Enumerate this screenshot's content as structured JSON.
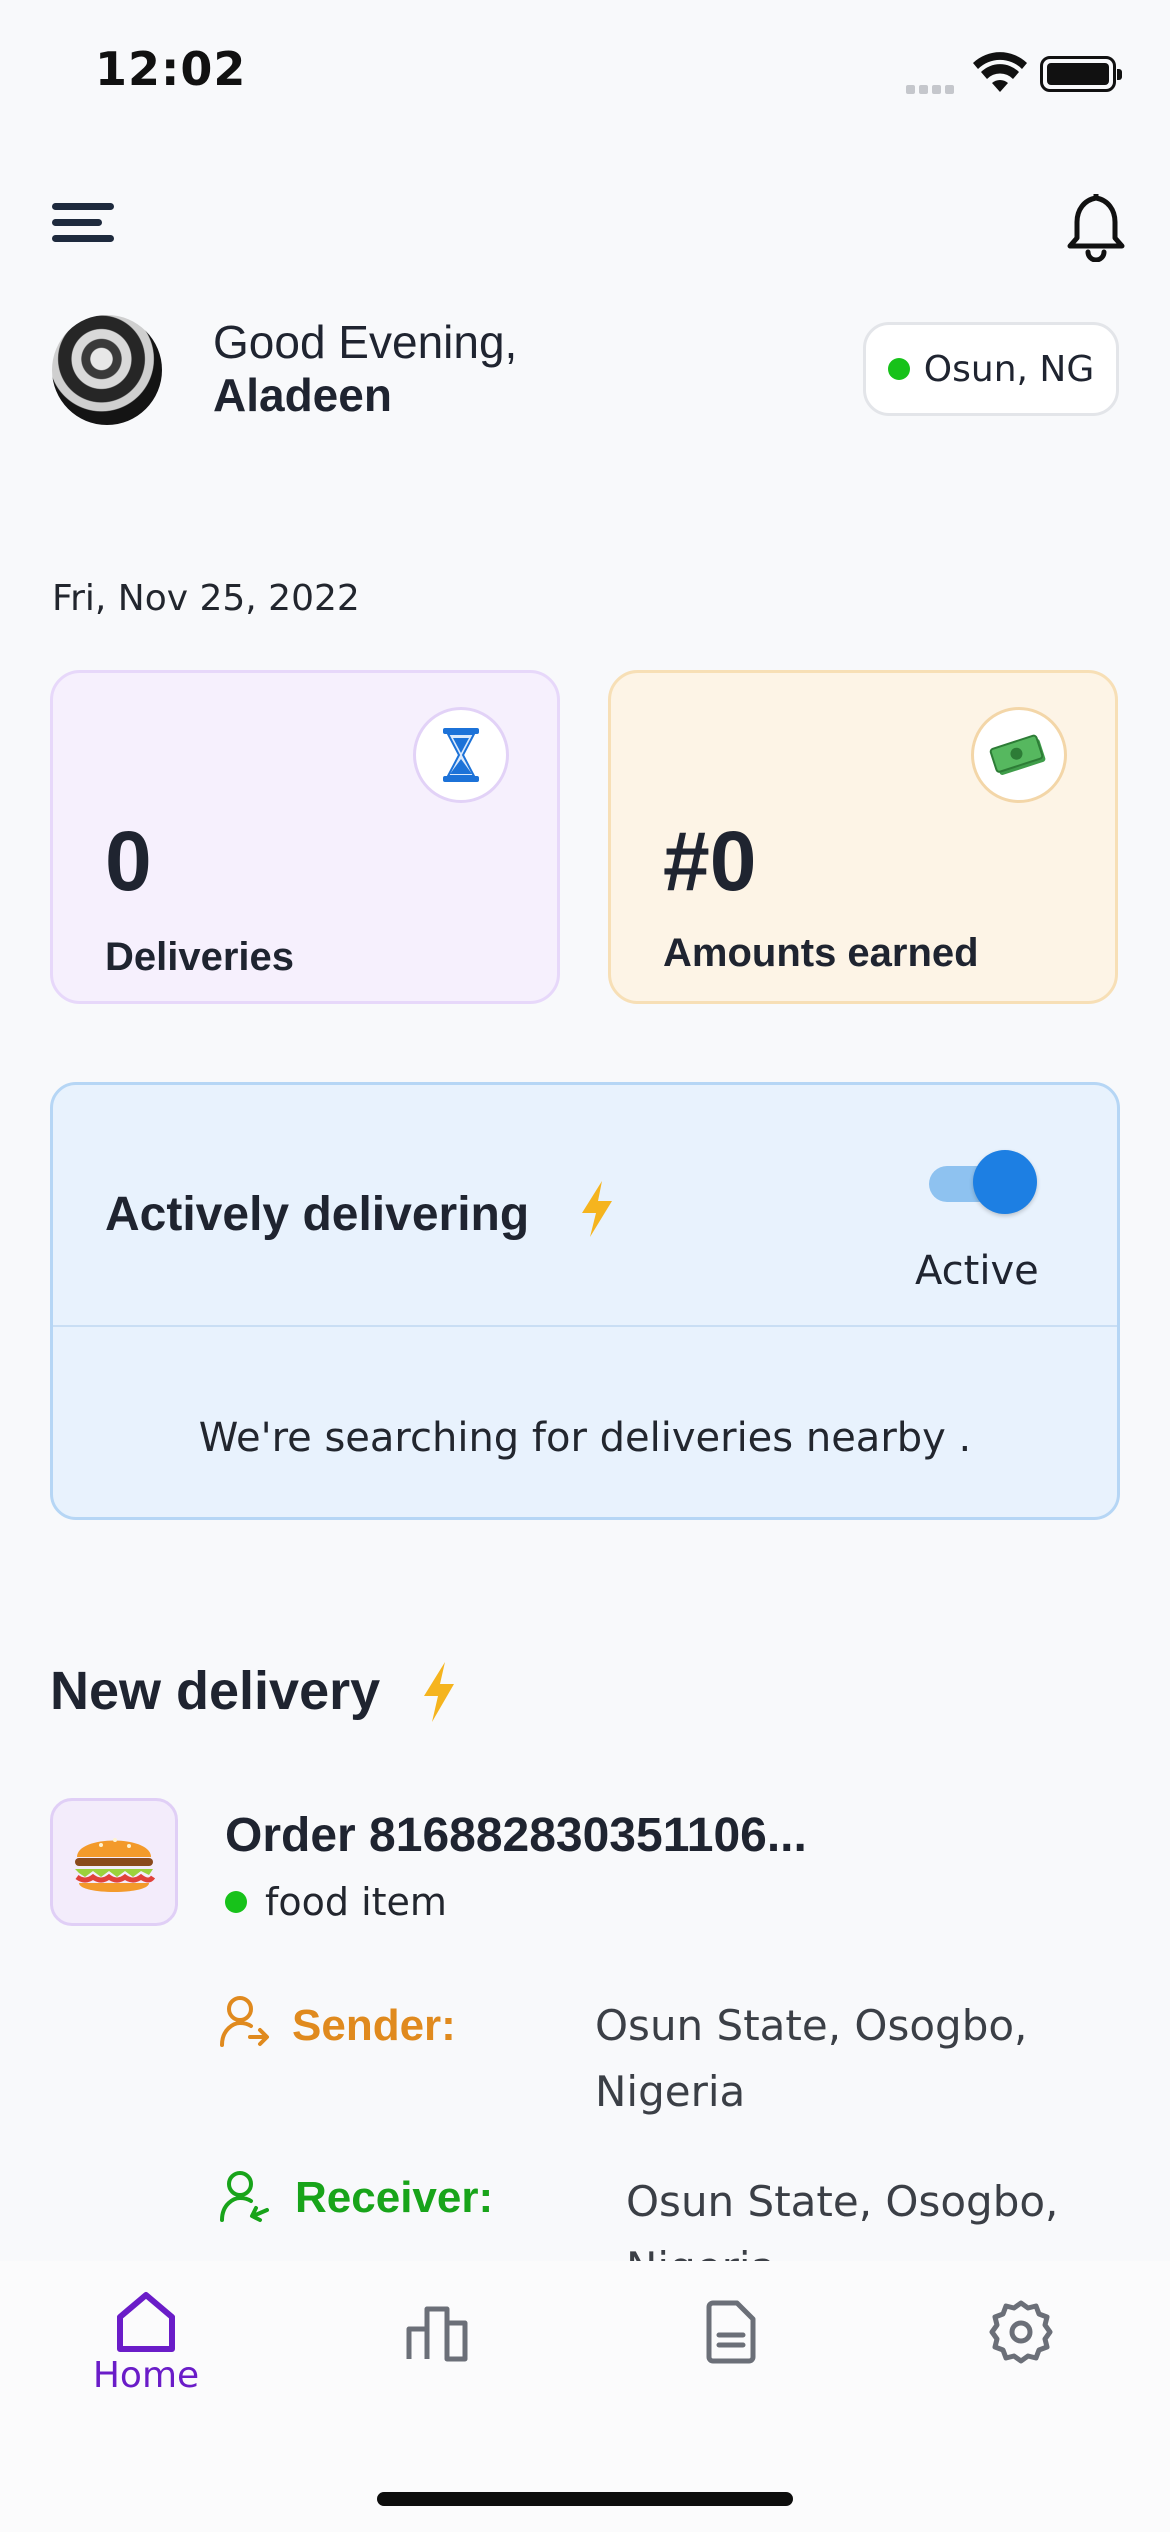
{
  "status_bar": {
    "time": "12:02"
  },
  "header": {
    "menu_icon": "menu-icon",
    "notification_icon": "bell-icon"
  },
  "greeting": {
    "line": "Good Evening,",
    "name": "Aladeen"
  },
  "location": {
    "label": "Osun, NG",
    "status_color": "#17c21a"
  },
  "date": "Fri, Nov 25, 2022",
  "stats": {
    "deliveries": {
      "value": "0",
      "label": "Deliveries",
      "icon": "hourglass-icon"
    },
    "earned": {
      "value": "#0",
      "label": "Amounts earned",
      "icon": "money-icon"
    }
  },
  "active_panel": {
    "title": "Actively delivering",
    "toggle_on": true,
    "status": "Active",
    "message": "We're searching for deliveries nearby ."
  },
  "new_delivery": {
    "title": "New delivery",
    "order": {
      "title": "Order 816882830351106...",
      "type": "food item",
      "thumb_icon": "burger-icon",
      "sender_label": "Sender:",
      "sender_address": "Osun State, Osogbo, Nigeria",
      "receiver_label": "Receiver:",
      "receiver_address": "Osun State, Osogbo, Nigeria"
    }
  },
  "bottom_nav": {
    "items": [
      {
        "label": "Home",
        "icon": "home-icon",
        "active": true
      },
      {
        "label": "",
        "icon": "stats-icon",
        "active": false
      },
      {
        "label": "",
        "icon": "document-icon",
        "active": false
      },
      {
        "label": "",
        "icon": "settings-icon",
        "active": false
      }
    ]
  },
  "colors": {
    "accent": "#6a1cc8",
    "toggle": "#1d7fe3",
    "sender": "#e08a1e",
    "receiver": "#18a41a",
    "bolt": "#f5b41e"
  }
}
